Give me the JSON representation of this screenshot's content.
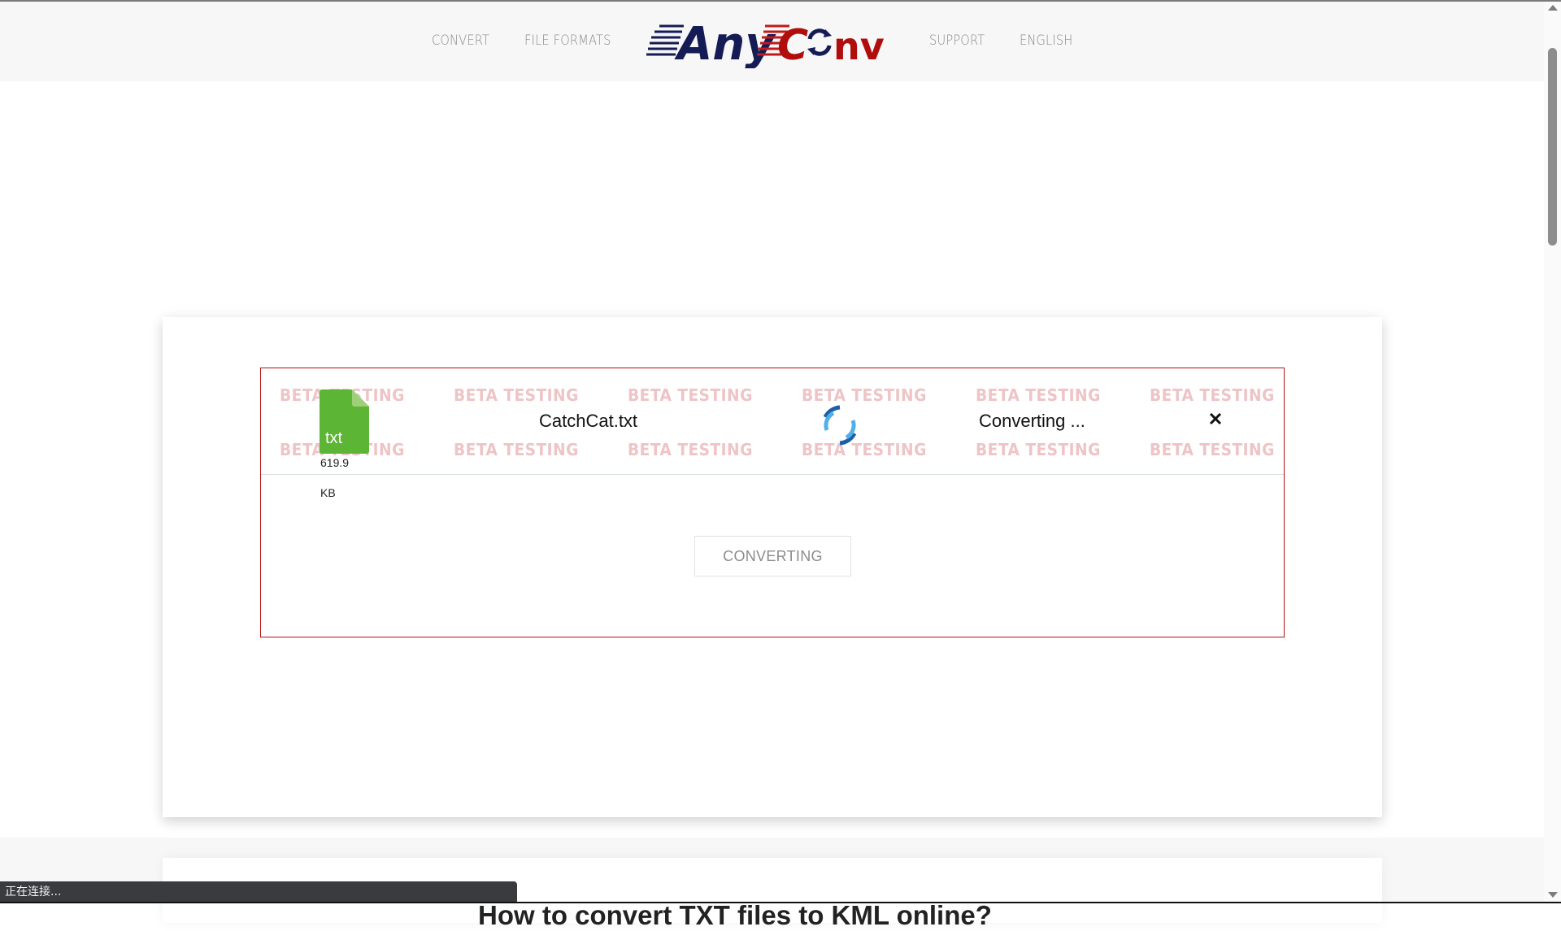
{
  "header": {
    "nav_left": [
      "CONVERT",
      "FILE FORMATS"
    ],
    "nav_right": [
      "SUPPORT",
      "ENGLISH"
    ],
    "logo": {
      "part1": "Any",
      "part2": "C",
      "part3": "nv",
      "icon": "refresh-arrows-icon",
      "colors": {
        "dark": "#151b54",
        "red": "#b00d0d"
      }
    }
  },
  "converter": {
    "watermark_text": "BETA TESTING",
    "file": {
      "icon": "file-icon",
      "extension": "txt",
      "size_value": "619.9",
      "size_unit": "KB",
      "name": "CatchCat.txt",
      "icon_color": "#5db535"
    },
    "status": "Converting ...",
    "spinner_icon": "loading-spinner-icon",
    "close_icon": "close-icon",
    "button_label": "CONVERTING",
    "border_color": "#b31212"
  },
  "section": {
    "heading": "How to convert TXT files to KML online?"
  },
  "browser_status": "正在连接..."
}
